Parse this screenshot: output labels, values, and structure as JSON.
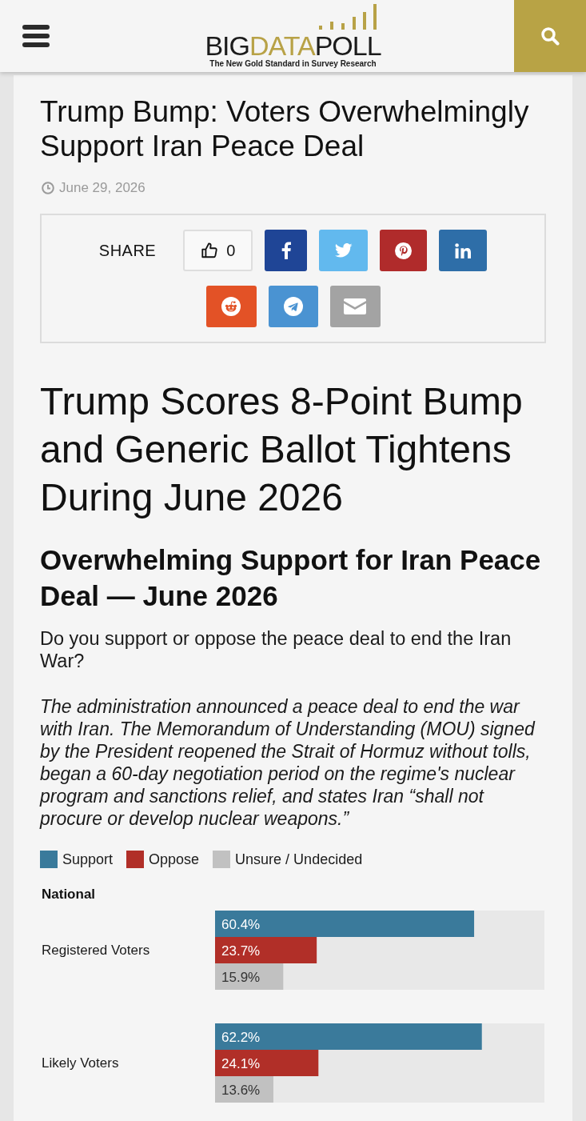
{
  "header": {
    "logo": {
      "wordmark": [
        {
          "text": "BIG",
          "accent": false
        },
        {
          "text": "DATA",
          "accent": true
        },
        {
          "text": "POLL",
          "accent": false
        }
      ],
      "tagline": "The New Gold Standard in Survey Research"
    }
  },
  "article": {
    "title": "Trump Bump: Voters Overwhelmingly Support Iran Peace Deal",
    "date": "June 29, 2026"
  },
  "share": {
    "label": "SHARE",
    "likes": "0",
    "buttons": [
      {
        "kind": "facebook"
      },
      {
        "kind": "twitter"
      },
      {
        "kind": "pinterest"
      },
      {
        "kind": "linkedin"
      },
      {
        "kind": "reddit"
      },
      {
        "kind": "telegram"
      },
      {
        "kind": "email"
      }
    ]
  },
  "content": {
    "heading": "Trump Scores 8-Point Bump and Generic Ballot Tightens During June 2026",
    "subheading": "Overwhelming Support for Iran Peace Deal — June 2026",
    "question": "Do you support or oppose the peace deal to end the Iran War?",
    "description": "The administration announced a peace deal to end the war with Iran. The Memorandum of Understanding (MOU) signed by the President reopened the Strait of Hormuz without tolls, began a 60-day negotiation period on the regime's nuclear program and sanctions relief, and states Iran “shall not procure or develop nuclear weapons.”",
    "chart": {
      "chart_data": {
        "type": "bar",
        "orientation": "horizontal",
        "title": "National",
        "legend": "top",
        "categories": [
          "Registered Voters",
          "Likely Voters"
        ],
        "series": [
          {
            "name": "Support",
            "color": "#3a7a9b",
            "values": [
              60.4,
              62.2
            ],
            "value_labels": [
              "60.4%",
              "62.2%"
            ]
          },
          {
            "name": "Oppose",
            "color": "#b12f28",
            "values": [
              23.7,
              24.1
            ],
            "value_labels": [
              "23.7%",
              "24.1%"
            ]
          },
          {
            "name": "Unsure / Undecided",
            "color": "#c1c1c1",
            "values": [
              15.9,
              13.6
            ],
            "value_labels": [
              "15.9%",
              "13.6%"
            ]
          }
        ]
      }
    }
  }
}
